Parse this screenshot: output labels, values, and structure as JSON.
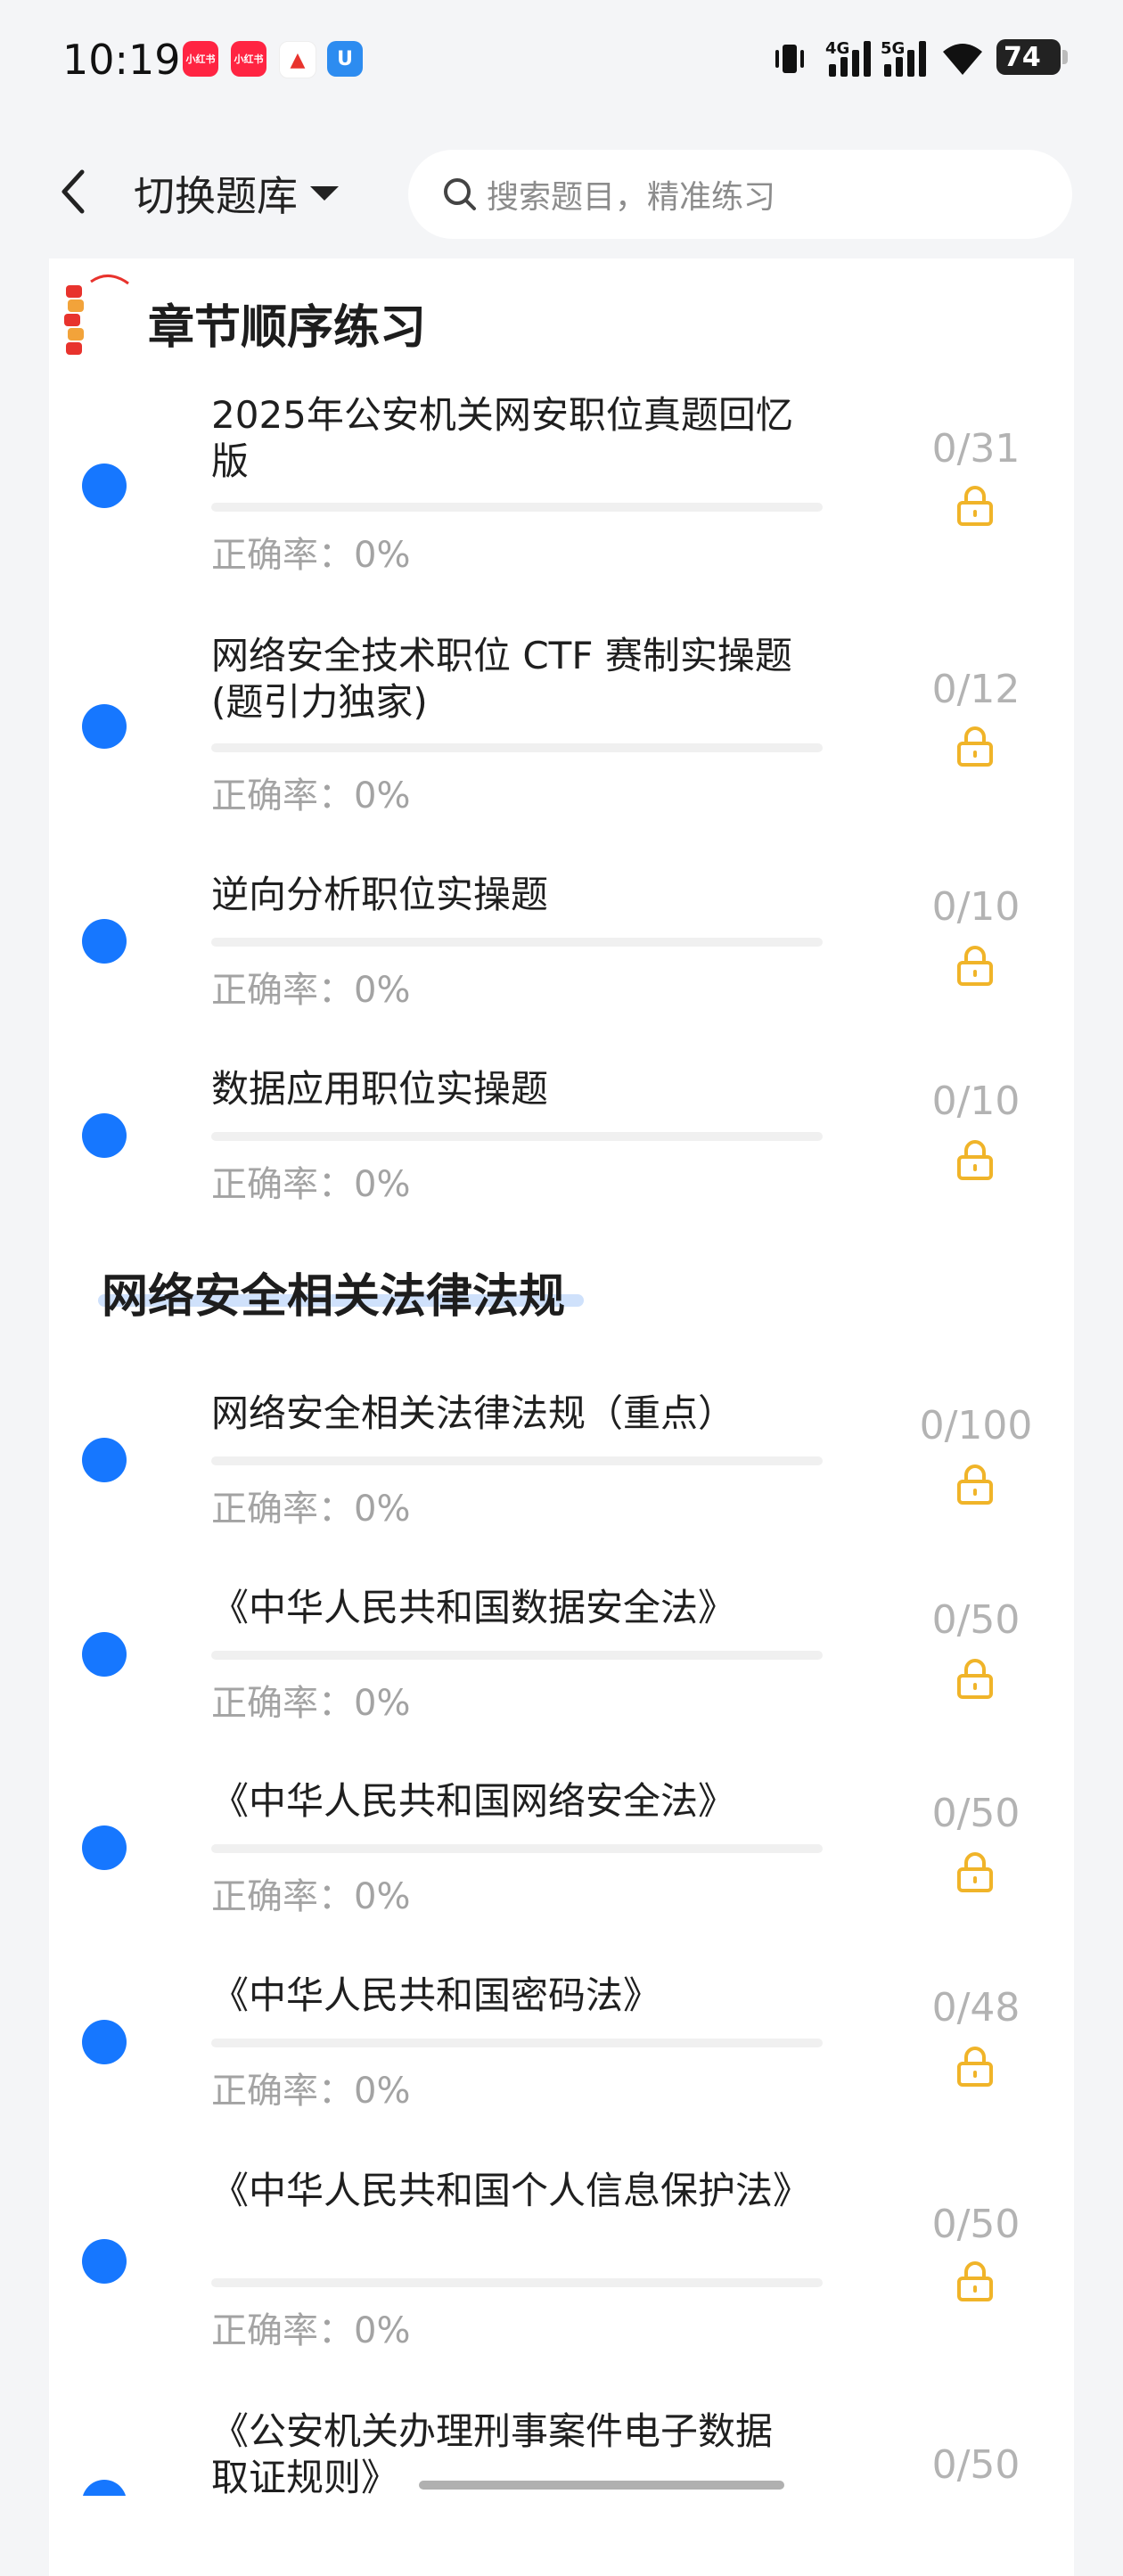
{
  "status_bar": {
    "time": "10:19",
    "apps": [
      "小红书",
      "小红书",
      "▲",
      "U"
    ],
    "network": [
      "4G",
      "5G"
    ],
    "battery": "74"
  },
  "header": {
    "back_icon": "chevron-left-icon",
    "switch_label": "切换题库",
    "search_placeholder": "搜索题目，精准练习"
  },
  "sections": [
    {
      "title": "章节顺序练习",
      "items": [
        {
          "title": "2025年公安机关网安职位真题回忆版",
          "accuracy": "正确率：0%",
          "count": "0/31"
        },
        {
          "title": "网络安全技术职位 CTF 赛制实操题(题引力独家)",
          "accuracy": "正确率：0%",
          "count": "0/12"
        },
        {
          "title": "逆向分析职位实操题",
          "accuracy": "正确率：0%",
          "count": "0/10"
        },
        {
          "title": "数据应用职位实操题",
          "accuracy": "正确率：0%",
          "count": "0/10"
        }
      ]
    },
    {
      "title": "网络安全相关法律法规",
      "items": [
        {
          "title": "网络安全相关法律法规（重点）",
          "accuracy": "正确率：0%",
          "count": "0/100"
        },
        {
          "title": "《中华人民共和国数据安全法》",
          "accuracy": "正确率：0%",
          "count": "0/50"
        },
        {
          "title": "《中华人民共和国网络安全法》",
          "accuracy": "正确率：0%",
          "count": "0/50"
        },
        {
          "title": "《中华人民共和国密码法》",
          "accuracy": "正确率：0%",
          "count": "0/48"
        },
        {
          "title": "《中华人民共和国个人信息保护法》",
          "accuracy": "正确率：0%",
          "count": "0/50"
        },
        {
          "title": "《公安机关办理刑事案件电子数据取证规则》",
          "accuracy": "",
          "count": "0/50"
        }
      ]
    }
  ],
  "colors": {
    "accent": "#1677ff",
    "lock": "#f0b429",
    "muted": "#a3a3a3"
  }
}
